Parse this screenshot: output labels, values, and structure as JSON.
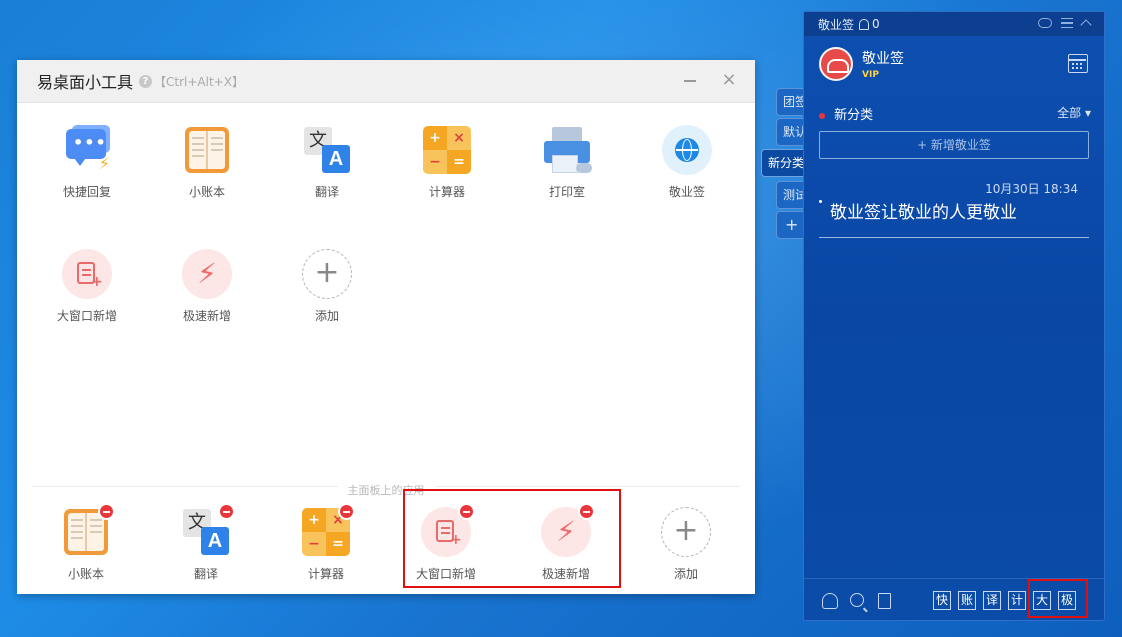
{
  "tools_window": {
    "title": "易桌面小工具",
    "shortcut": "【Ctrl+Alt+X】",
    "help": "?",
    "close": "×",
    "apps_row1": [
      {
        "label": "快捷回复",
        "icon": "chat-icon"
      },
      {
        "label": "小账本",
        "icon": "book-icon"
      },
      {
        "label": "翻译",
        "icon": "translate-icon"
      },
      {
        "label": "计算器",
        "icon": "calculator-icon"
      },
      {
        "label": "打印室",
        "icon": "printer-icon"
      },
      {
        "label": "敬业签",
        "icon": "globe-icon"
      }
    ],
    "apps_row2": [
      {
        "label": "大窗口新增",
        "icon": "note-add-icon"
      },
      {
        "label": "极速新增",
        "icon": "lightning-icon"
      },
      {
        "label": "添加",
        "icon": "plus-icon"
      }
    ],
    "section_label": "主面板上的应用",
    "pinned_apps": [
      {
        "label": "小账本",
        "icon": "book-icon"
      },
      {
        "label": "翻译",
        "icon": "translate-icon"
      },
      {
        "label": "计算器",
        "icon": "calculator-icon"
      },
      {
        "label": "大窗口新增",
        "icon": "note-add-icon"
      },
      {
        "label": "极速新增",
        "icon": "lightning-icon"
      },
      {
        "label": "添加",
        "icon": "plus-icon"
      }
    ],
    "icon_glyphs": {
      "wen": "文",
      "a": "A",
      "plus": "+",
      "times": "×",
      "minus": "−",
      "equals": "=",
      "bolt": "⚡",
      "dots": "•••"
    }
  },
  "side_tabs": [
    "团签",
    "默认",
    "新分类",
    "测试",
    "+"
  ],
  "notes_panel": {
    "app_name": "敬业签",
    "notification_count": "0",
    "user_name": "敬业签",
    "vip_label": "VIP",
    "category": "新分类",
    "filter": "全部 ▾",
    "add_note": "+ 新增敬业签",
    "note": {
      "time": "10月30日 18:34",
      "text": "敬业签让敬业的人更敬业"
    },
    "quick_buttons": [
      "快",
      "账",
      "译",
      "计",
      "大",
      "极"
    ]
  },
  "colors": {
    "highlight_red": "#e01010",
    "panel_blue": "#0b4ca8",
    "remove_badge": "#e8363a"
  }
}
